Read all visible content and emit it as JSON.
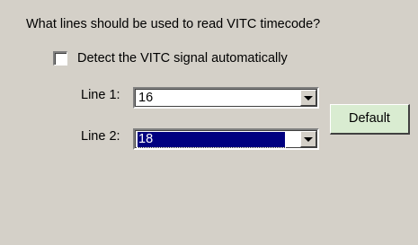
{
  "prompt": "What lines should be used to read VITC timecode?",
  "detect": {
    "label": "Detect the VITC signal automatically",
    "checked": false
  },
  "line1": {
    "label": "Line 1:",
    "value": "16"
  },
  "line2": {
    "label": "Line 2:",
    "value": "18"
  },
  "default_button": "Default",
  "icons": {
    "dropdown": "chevron-down-icon"
  }
}
